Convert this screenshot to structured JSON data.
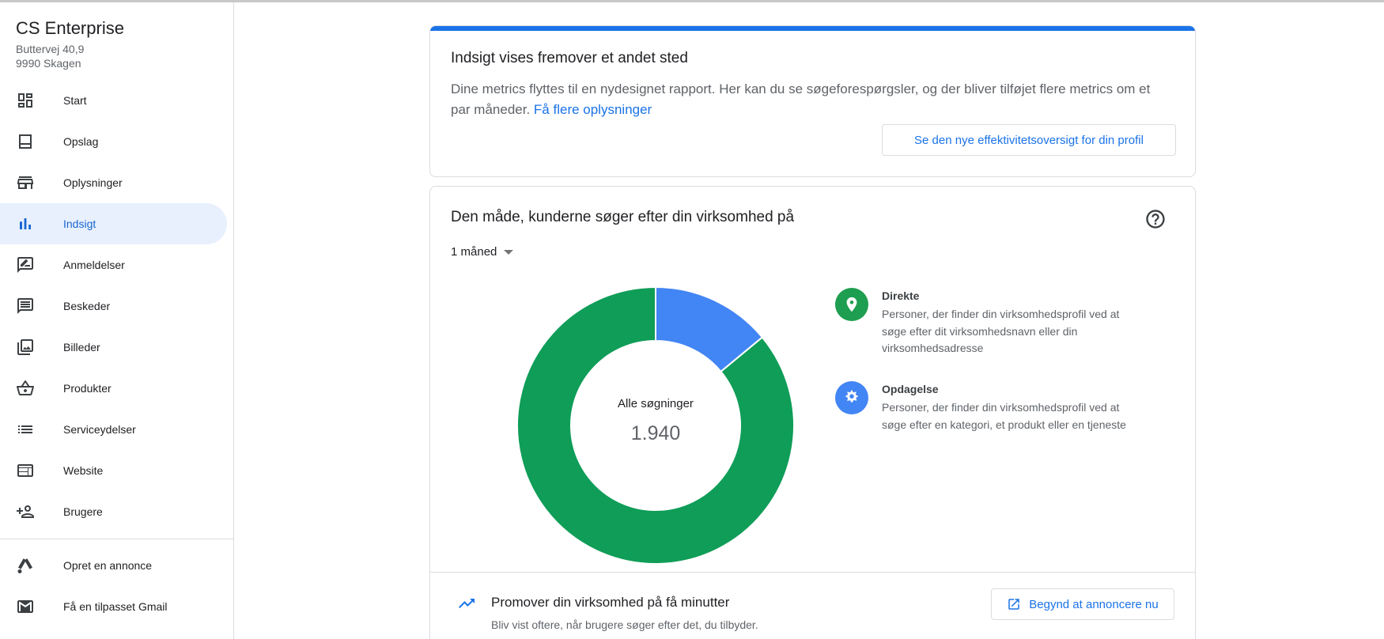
{
  "business": {
    "name": "CS Enterprise",
    "address_line1": "Buttervej 40,9",
    "address_line2": "9990 Skagen"
  },
  "sidebar": {
    "items": [
      {
        "label": "Start",
        "icon": "dashboard-icon"
      },
      {
        "label": "Opslag",
        "icon": "posts-icon"
      },
      {
        "label": "Oplysninger",
        "icon": "storefront-icon"
      },
      {
        "label": "Indsigt",
        "icon": "bar-chart-icon",
        "active": true
      },
      {
        "label": "Anmeldelser",
        "icon": "rate-review-icon"
      },
      {
        "label": "Beskeder",
        "icon": "message-icon"
      },
      {
        "label": "Billeder",
        "icon": "photo-library-icon"
      },
      {
        "label": "Produkter",
        "icon": "basket-icon"
      },
      {
        "label": "Serviceydelser",
        "icon": "list-icon"
      },
      {
        "label": "Website",
        "icon": "web-icon"
      },
      {
        "label": "Brugere",
        "icon": "person-add-icon"
      }
    ],
    "secondary_items": [
      {
        "label": "Opret en annonce",
        "icon": "google-ads-icon"
      },
      {
        "label": "Få en tilpasset Gmail",
        "icon": "gmail-icon"
      }
    ]
  },
  "notice_card": {
    "title": "Indsigt vises fremover et andet sted",
    "body": "Dine metrics flyttes til en nydesignet rapport. Her kan du se søgeforespørgsler, og der bliver tilføjet flere metrics om et par måneder.",
    "link": "Få flere oplysninger",
    "button": "Se den nye effektivitetsoversigt for din profil"
  },
  "search_card": {
    "title": "Den måde, kunderne søger efter din virksomhed på",
    "period": "1 måned",
    "center_label": "Alle søgninger",
    "center_value": "1.940",
    "legend": [
      {
        "name": "Direkte",
        "desc": "Personer, der finder din virksomhedsprofil ved at søge efter dit virksomhedsnavn eller din virksomhedsadresse",
        "color": "#0f9d58"
      },
      {
        "name": "Opdagelse",
        "desc": "Personer, der finder din virksomhedsprofil ved at søge efter en kategori, et produkt eller en tjeneste",
        "color": "#4285f4"
      }
    ],
    "promo_title": "Promover din virksomhed på få minutter",
    "promo_sub": "Bliv vist oftere, når brugere søger efter det, du tilbyder.",
    "promo_button": "Begynd at annoncere nu"
  },
  "chart_data": {
    "type": "pie",
    "categories": [
      "Direkte",
      "Opdagelse"
    ],
    "values": [
      0.86,
      0.14
    ],
    "colors": [
      "#0f9d58",
      "#4285f4"
    ],
    "total": "1.940"
  }
}
